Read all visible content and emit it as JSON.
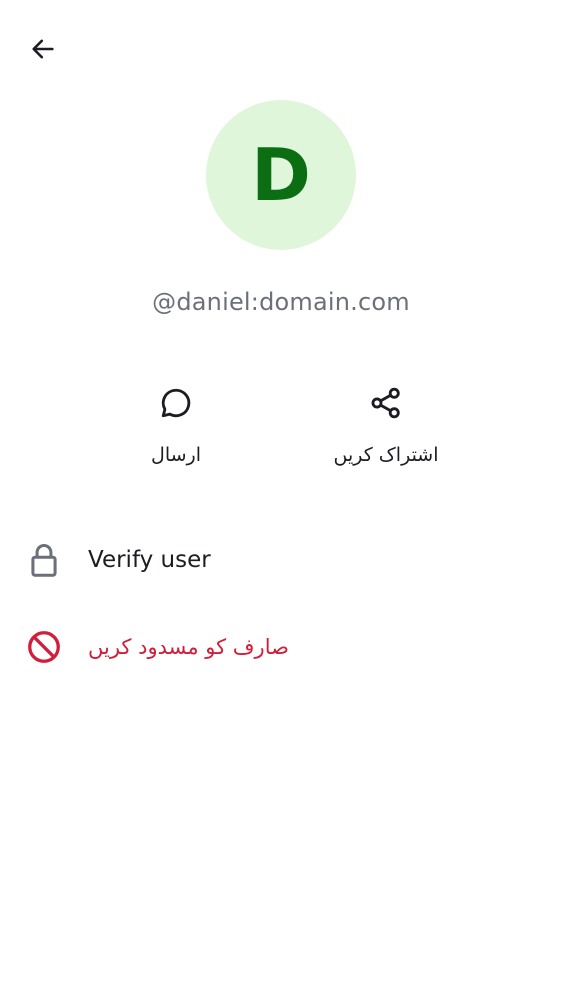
{
  "header": {
    "back_icon": "arrow-left-icon"
  },
  "profile": {
    "avatar_letter": "D",
    "avatar_bg": "#dff6da",
    "avatar_fg": "#0b6e12",
    "user_id": "@daniel:domain.com"
  },
  "actions": {
    "send": {
      "icon": "chat-bubble-icon",
      "label": "ارسال"
    },
    "share": {
      "icon": "share-icon",
      "label": "اشتراک کریں"
    }
  },
  "options": {
    "verify": {
      "icon": "lock-icon",
      "label": "Verify user"
    },
    "block": {
      "icon": "block-icon",
      "label": "صارف کو مسدود کریں",
      "color": "#d21d3b"
    }
  }
}
